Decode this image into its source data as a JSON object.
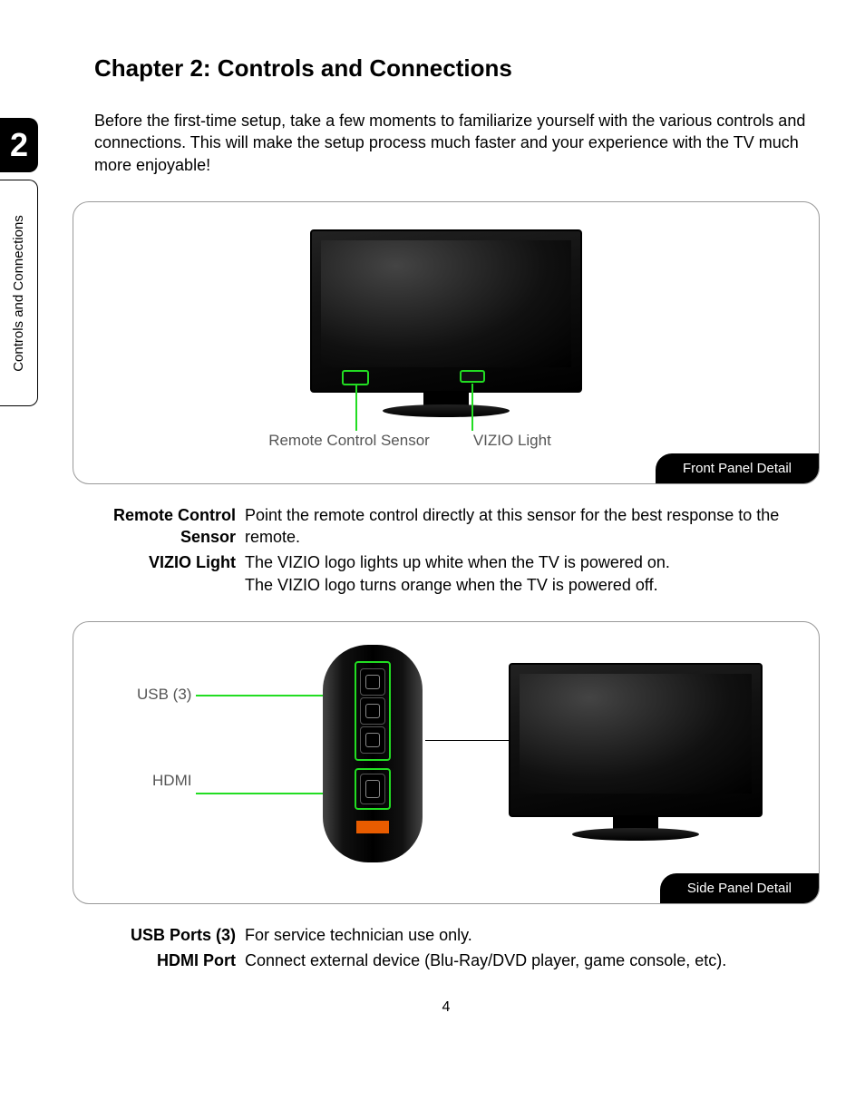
{
  "chapter": {
    "number": "2",
    "tab_label": "Controls and Connections",
    "title": "Chapter 2: Controls and Connections",
    "intro": "Before the first-time setup, take a few moments to familiarize yourself with the various controls and connections. This will make the setup process much faster and your experience with the TV much more enjoyable!"
  },
  "front_panel": {
    "badge": "Front Panel Detail",
    "labels": {
      "sensor": "Remote Control Sensor",
      "light": "VIZIO Light"
    },
    "definitions": [
      {
        "term": "Remote Control Sensor",
        "desc": "Point the remote control directly at this sensor for the best response to the remote."
      },
      {
        "term": "VIZIO Light",
        "desc": "The VIZIO logo lights up white when the TV is powered on.\nThe VIZIO logo turns orange when the TV is powered off."
      }
    ]
  },
  "side_panel": {
    "badge": "Side Panel Detail",
    "labels": {
      "usb": "USB (3)",
      "hdmi": "HDMI"
    },
    "definitions": [
      {
        "term": "USB Ports (3)",
        "desc": "For service technician use only."
      },
      {
        "term": "HDMI Port",
        "desc": "Connect external device (Blu-Ray/DVD player, game console, etc)."
      }
    ]
  },
  "page_number": "4"
}
